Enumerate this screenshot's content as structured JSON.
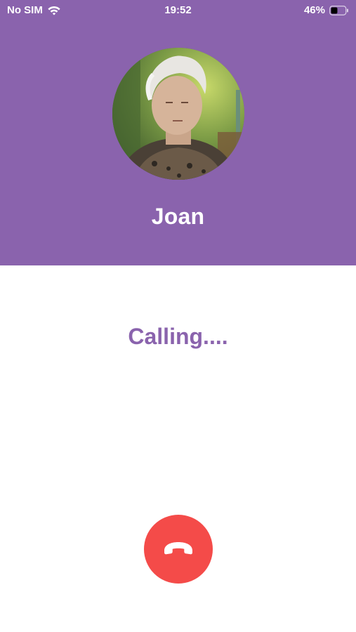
{
  "status_bar": {
    "carrier": "No SIM",
    "time": "19:52",
    "battery_percent": "46%",
    "battery_level": 0.46,
    "wifi_icon": "wifi-icon",
    "battery_icon": "battery-icon"
  },
  "contact": {
    "name": "Joan",
    "avatar_icon": "contact-photo"
  },
  "call": {
    "status_text": "Calling....",
    "hangup_icon": "phone-hangup-icon"
  },
  "colors": {
    "header_bg": "#8a63ad",
    "accent": "#8a63ad",
    "hangup_red": "#f44b49",
    "text_on_header": "#ffffff"
  }
}
